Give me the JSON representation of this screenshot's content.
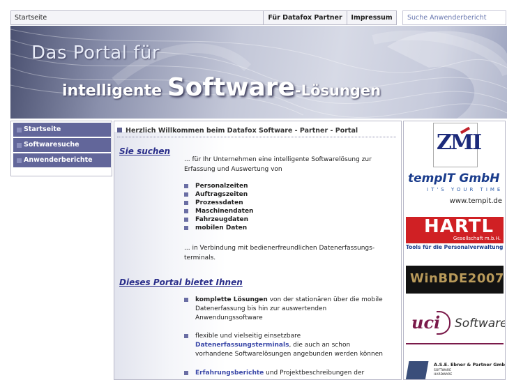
{
  "topbar": {
    "home": "Startseite",
    "partner": "Für Datafox Partner",
    "impressum": "Impressum",
    "search_label": "Suche Anwenderbericht"
  },
  "banner": {
    "line1": "Das Portal für",
    "line2_a": "intelligente ",
    "line2_b": "Software",
    "line2_c": "-Lösungen"
  },
  "nav": {
    "items": [
      {
        "label": "Startseite"
      },
      {
        "label": "Softwaresuche"
      },
      {
        "label": "Anwenderberichte"
      }
    ]
  },
  "main": {
    "welcome": "Herzlich Willkommen beim Datafox Software - Partner - Portal",
    "section1": {
      "heading": "Sie suchen",
      "intro": "... für Ihr Unternehmen eine intelligente Softwarelösung zur Erfassung und Auswertung von",
      "bullets": [
        "Personalzeiten",
        "Auftragszeiten",
        "Prozessdaten",
        "Maschinendaten",
        "Fahrzeugdaten",
        "mobilen Daten"
      ],
      "outro": "... in Verbindung mit bedienerfreundlichen Datenerfassungs-terminals."
    },
    "section2": {
      "heading": "Dieses Portal bietet Ihnen",
      "b1_bold": "komplette Lösungen",
      "b1_rest": " von der stationären über die mobile Datenerfassung bis hin zur auswertenden Anwendungssoftware",
      "b2_pre": "flexible und vielseitig einsetzbare ",
      "b2_link": "Datenerfassungsterminals",
      "b2_post": ", die auch an schon vorhandene Softwarelösungen angebunden werden können",
      "b3_link": "Erfahrungsberichte",
      "b3_post": " und Projektbeschreibungen der"
    }
  },
  "partners": {
    "zmi": "ZMI",
    "tempit_name": "tempIT GmbH",
    "tempit_slogan": "IT'S YOUR TIME",
    "tempit_url": "www.tempit.de",
    "hartl_name": "HARTL",
    "hartl_sub": "Gesellschaft m.b.H.",
    "hartl_tag": "Tools für die Personalverwaltung",
    "winbde": "WinBDE2007",
    "uci_a": "uci",
    "uci_b": "Software",
    "ase": "A.S.E. Ebner & Partner GmbH",
    "ase_sub1": "SOFTWARE",
    "ase_sub2": "HARDWARE"
  }
}
